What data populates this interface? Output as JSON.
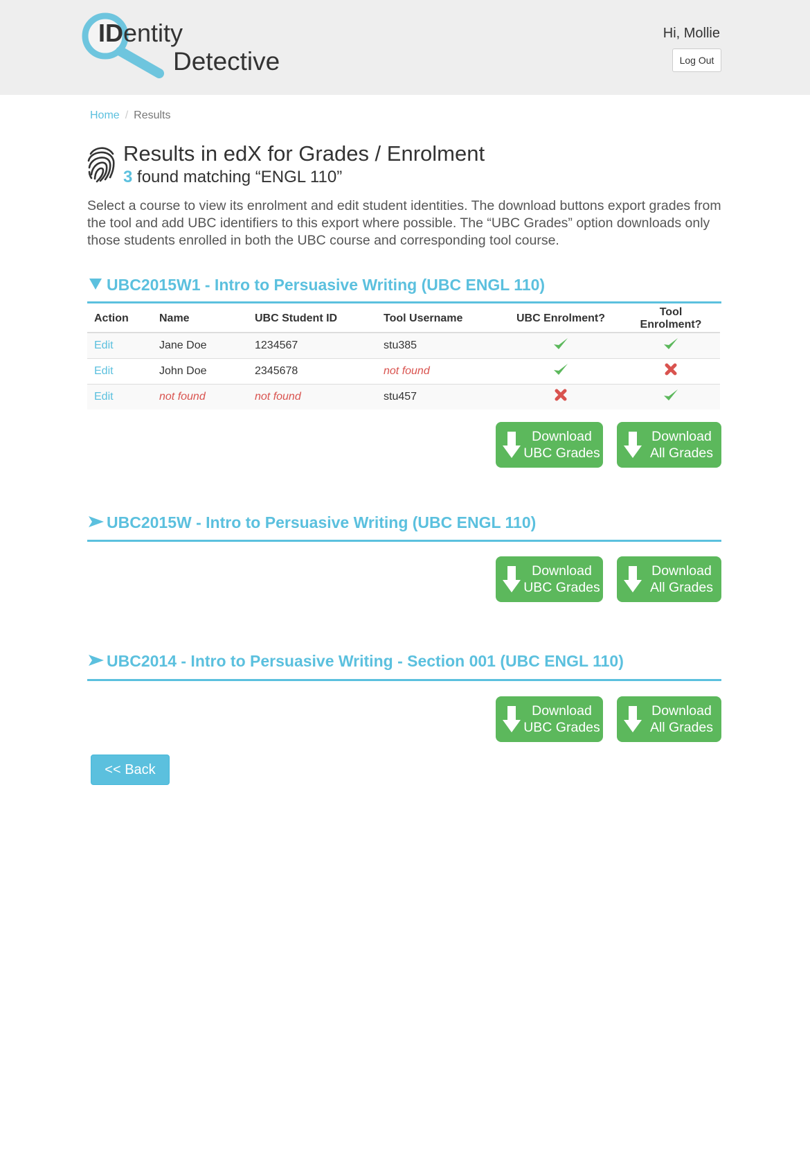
{
  "header": {
    "logo_bold": "ID",
    "logo_rest": "entity",
    "logo_line2": "Detective",
    "greeting": "Hi, Mollie",
    "logout_label": "Log Out"
  },
  "breadcrumb": {
    "home": "Home",
    "separator": "/",
    "current": "Results"
  },
  "title": {
    "heading": "Results in edX for Grades / Enrolment",
    "count": "3",
    "subtitle_rest": " found matching “ENGL 110”",
    "intro": "Select a course to view its enrolment and edit student identities. The download buttons export grades from the tool and add UBC identifiers to this export where possible. The “UBC Grades” option downloads only those students enrolled in both the UBC course and corresponding tool course."
  },
  "download": {
    "ubc_line1": "Download",
    "ubc_line2": "UBC Grades",
    "all_line1": "Download",
    "all_line2": "All Grades"
  },
  "sections": [
    {
      "expanded": true,
      "title": "UBC2015W1 - Intro to Persuasive Writing (UBC ENGL 110)",
      "table": {
        "headers": [
          "Action",
          "Name",
          "UBC Student ID",
          "Tool Username",
          "UBC Enrolment?",
          "Tool Enrolment?"
        ],
        "rows": [
          {
            "action": "Edit",
            "name": "Jane Doe",
            "student_id": "1234567",
            "tool_username": "stu385",
            "ubc_enrolled": true,
            "tool_enrolled": true
          },
          {
            "action": "Edit",
            "name": "John Doe",
            "student_id": "2345678",
            "tool_username": "not found",
            "ubc_enrolled": true,
            "tool_enrolled": false
          },
          {
            "action": "Edit",
            "name": "not found",
            "student_id": "not found",
            "tool_username": "stu457",
            "ubc_enrolled": false,
            "tool_enrolled": true
          }
        ]
      }
    },
    {
      "expanded": false,
      "title": "UBC2015W - Intro to Persuasive Writing (UBC ENGL 110)"
    },
    {
      "expanded": false,
      "title": "UBC2014 - Intro to Persuasive Writing - Section 001 (UBC ENGL 110)"
    }
  ],
  "back_label": "<< Back",
  "colors": {
    "accent": "#5bc0de",
    "success": "#5cb85c",
    "danger": "#d9534f",
    "header_bg": "#eeeeee"
  },
  "icons": {
    "logo": "magnifier-icon",
    "title": "fingerprint-icon",
    "expanded": "triangle-down-icon",
    "collapsed": "arrow-right-icon",
    "yes": "check-icon",
    "no": "cross-icon",
    "download": "arrow-down-icon"
  }
}
